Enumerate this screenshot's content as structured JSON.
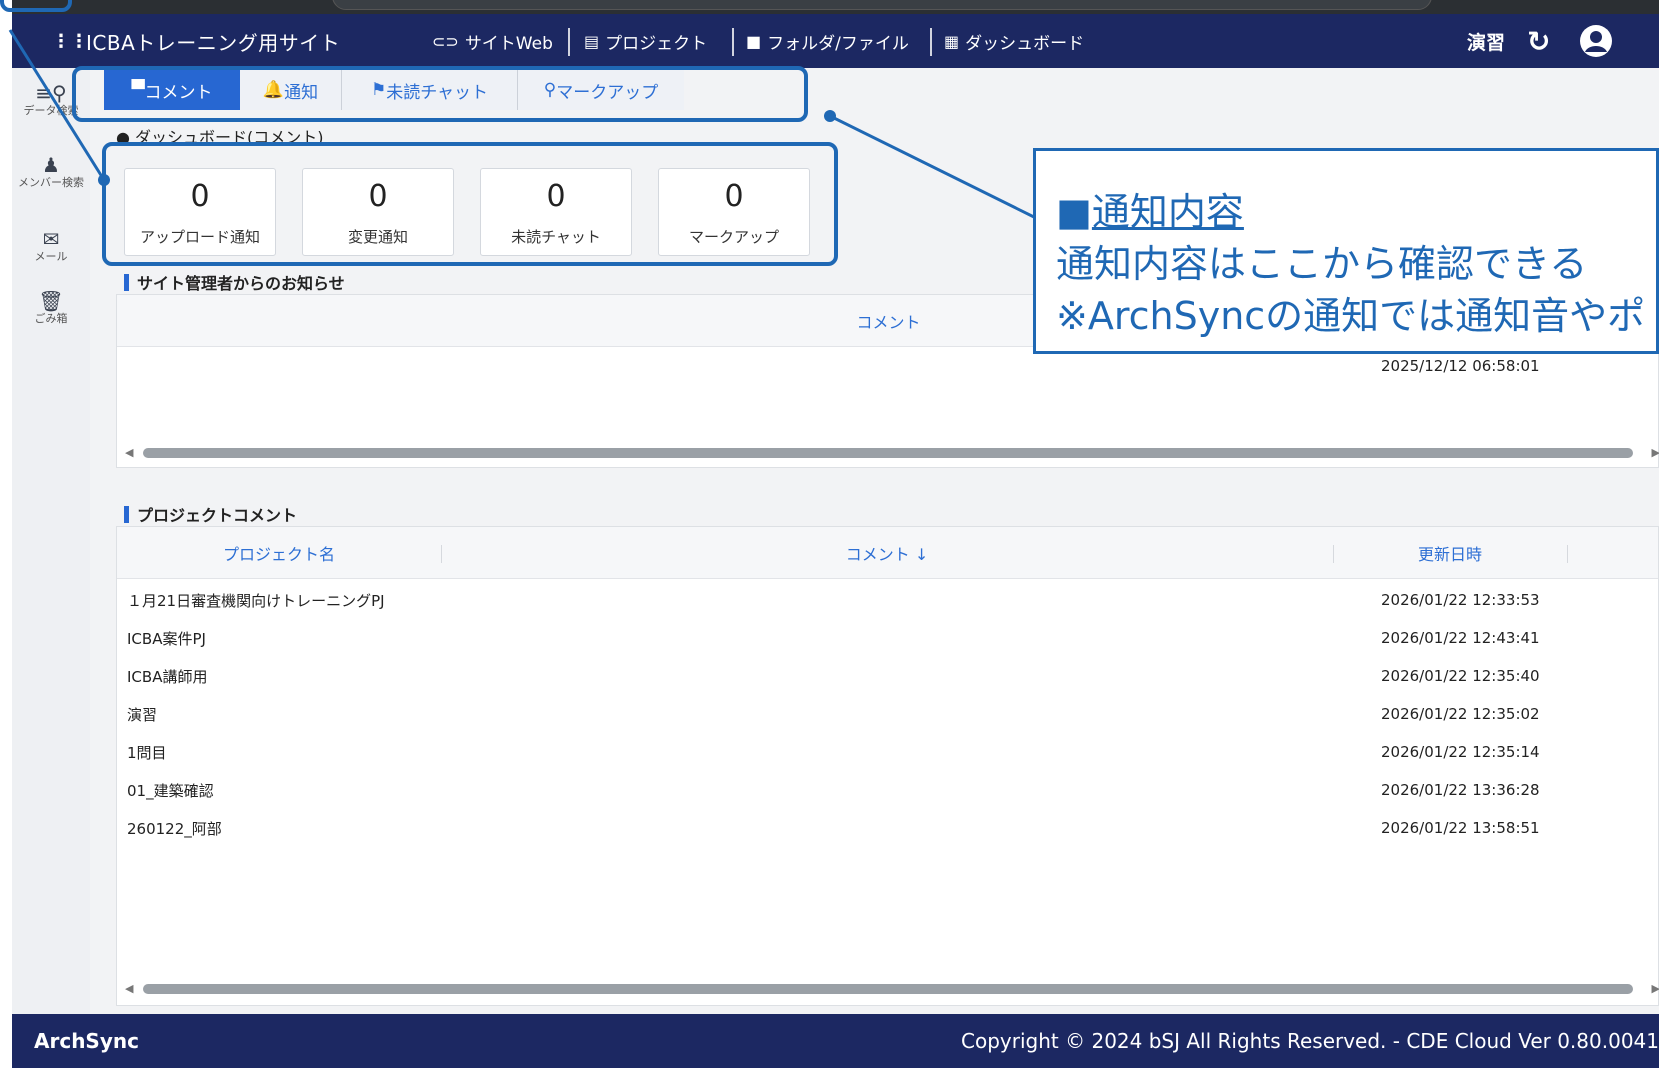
{
  "header": {
    "app_icon": "grid-icon",
    "site_title": "ICBAトレーニング用サイト",
    "nav": [
      {
        "icon": "link-icon",
        "label": "サイトWeb"
      },
      {
        "icon": "archive-icon",
        "label": "プロジェクト"
      },
      {
        "icon": "folder-icon",
        "label": "フォルダ/ファイル"
      },
      {
        "icon": "dashboard-icon",
        "label": "ダッシュボード"
      }
    ],
    "project": "演習",
    "refresh_icon": "refresh-icon",
    "user_icon": "user-icon"
  },
  "sidebar": {
    "items": [
      {
        "icon": "data-search-icon",
        "label": "データ検索"
      },
      {
        "icon": "member-search-icon",
        "label": "メンバー検索"
      },
      {
        "icon": "mail-icon",
        "label": "メール"
      },
      {
        "icon": "trash-icon",
        "label": "ごみ箱"
      }
    ]
  },
  "tabs": [
    {
      "icon": "comment-icon",
      "label": "コメント",
      "active": true
    },
    {
      "icon": "bell-icon",
      "label": "通知",
      "active": false
    },
    {
      "icon": "flag-icon",
      "label": "未読チャット",
      "active": false
    },
    {
      "icon": "pin-icon",
      "label": "マークアップ",
      "active": false
    }
  ],
  "dashboard_heading": "● ダッシュボード(コメント)",
  "stats": [
    {
      "value": "0",
      "label": "アップロード通知"
    },
    {
      "value": "0",
      "label": "変更通知"
    },
    {
      "value": "0",
      "label": "未読チャット"
    },
    {
      "value": "0",
      "label": "マークアップ"
    }
  ],
  "admin_notice": {
    "title": "サイト管理者からのお知らせ",
    "column_comment": "コメント",
    "date": "2025/12/12 06:58:01"
  },
  "project_comments": {
    "title": "プロジェクトコメント",
    "columns": {
      "name": "プロジェクト名",
      "comment": "コメント ↓",
      "updated": "更新日時"
    },
    "rows": [
      {
        "name": "１月21日審査機関向けトレーニングPJ",
        "updated": "2026/01/22 12:33:53"
      },
      {
        "name": "ICBA案件PJ",
        "updated": "2026/01/22 12:43:41"
      },
      {
        "name": "ICBA講師用",
        "updated": "2026/01/22 12:35:40"
      },
      {
        "name": "演習",
        "updated": "2026/01/22 12:35:02"
      },
      {
        "name": "1問目",
        "updated": "2026/01/22 12:35:14"
      },
      {
        "name": "01_建築確認",
        "updated": "2026/01/22 13:36:28"
      },
      {
        "name": "260122_阿部",
        "updated": "2026/01/22 13:58:51"
      }
    ]
  },
  "footer": {
    "brand": "ArchSync",
    "copyright": "Copyright © 2024 bSJ All Rights Reserved. - CDE Cloud Ver 0.80.0041"
  },
  "callout": {
    "marker": "■",
    "title": "通知内容",
    "line1": "通知内容はここから確認できる",
    "line2": "※ArchSyncの通知では通知音やポ"
  },
  "colors": {
    "header_bg": "#1c2862",
    "accent": "#2767d2",
    "annotation": "#1f68b4"
  }
}
